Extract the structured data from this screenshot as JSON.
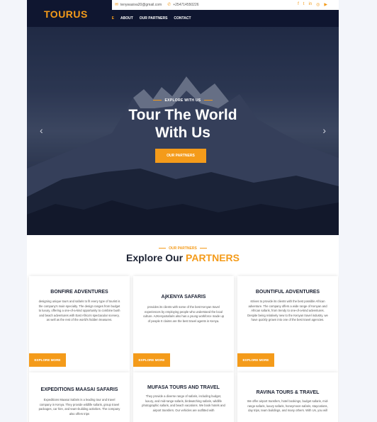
{
  "brand": {
    "logo": "TOURUS",
    "accent": "#f49b1a",
    "dark": "#0f1630"
  },
  "topbar": {
    "email": "tenywasiva20@gmail.com",
    "phone": "+254714550226",
    "social_icons": [
      "facebook-icon",
      "twitter-icon",
      "linkedin-icon",
      "instagram-icon",
      "youtube-icon"
    ]
  },
  "nav": {
    "items": [
      "HOME",
      "ABOUT",
      "OUR PARTNERS",
      "CONTACT"
    ],
    "active": "HOME"
  },
  "hero": {
    "eyebrow": "EXPLORE WITH US",
    "title_line1": "Tour The World",
    "title_line2": "With Us",
    "button": "OUR PARTNERS"
  },
  "partners": {
    "eyebrow": "OUR PARTNERS",
    "title_prefix": "Explore Our",
    "title_highlight": "PARTNERS",
    "cards": [
      {
        "title": "BONFIRE ADVENTURES",
        "text": "designing unique tours and safaris to fit every type of tourist is the company's main specialty. The design ranges from budget to luxury, offering a one-of-a-kind opportunity to combine bush and beach adventures with East Africa's spectacular scenery, as well as the rest of the world's hidden treasures.",
        "button": "EXPLORE MORE"
      },
      {
        "title": "AjKENYA SAFARIS",
        "text": "provides its clients with some of the best Kenyan travel experiences by employing people who understand the local culture. AJKenyaSafaris also has a young workforce made up of people It claims are the best travel agents in Kenya.",
        "button": "EXPLORE MORE"
      },
      {
        "title": "BOUNTIFUL ADVENTURES",
        "text": "strives to provide its clients with the best possible African adventure. The company offers a wide range of Kenyan and African safaris, from trendy to one-of-a-kind adventures. Despite being relatively new to the Kenyan travel industry, we have quickly grown into one of the best travel agencies.",
        "button": "EXPLORE MORE"
      },
      {
        "title": "EXPEDITIONS MAASAI SAFARIS",
        "text": "Expeditions Maasai Safaris is a leading tour and travel company in Kenya. They provide wildlife safaris, group travel packages, car hire, and team-building activities. The company also offers trips",
        "button": ""
      },
      {
        "title": "MUFASA TOURS AND TRAVEL",
        "text": "They provide a diverse range of safaris, including budget, luxury, and mid-range safaris, birdwatching safaris, wildlife photographic safaris, and beach vacations. We book hotels and airport transfers. Our vehicles are outfitted with",
        "button": ""
      },
      {
        "title": "RAVINA TOURS & TRAVEL",
        "text": "We offer airport transfers, hotel bookings, budget safaris, mid-range safaris, luxury safaris, honeymoon safaris, staycations, day trips, team buildings, and many others. With Us, you will",
        "button": ""
      }
    ]
  }
}
